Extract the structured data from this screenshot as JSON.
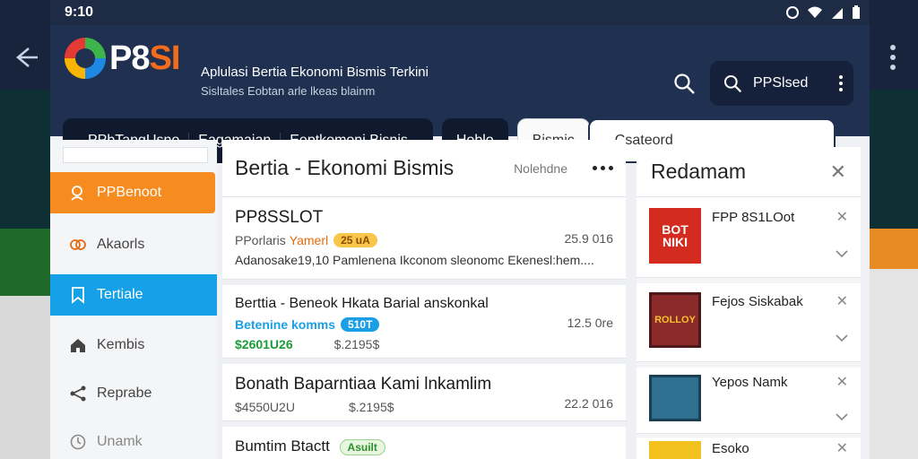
{
  "outer": {
    "back_icon": "back-arrow-icon",
    "more_icon": "more-vertical-icon"
  },
  "statusbar": {
    "time": "9:10",
    "icons": [
      "signal-icon",
      "wifi-icon",
      "battery-icon"
    ]
  },
  "app": {
    "logo_text_a": "P8",
    "logo_text_b": "SI",
    "title": "Aplulasi Bertia Ekonomi Bismis Terkini",
    "subtitle": "Sisltales Eobtan arle lkeas blainm",
    "search_label": "PPSlsed"
  },
  "tabs": {
    "group": [
      "PPbTangUsno",
      "Eagamaian",
      "Eeptkomoni Bisnis"
    ],
    "hoblo": "Hoblo",
    "bismic": "Bismic",
    "active": "Csateord"
  },
  "sidebar": {
    "items": [
      {
        "label": "PPBenoot",
        "icon": "person-search-icon"
      },
      {
        "label": "Akaorls",
        "icon": "link-icon"
      },
      {
        "label": "Tertiale",
        "icon": "bookmark-icon"
      },
      {
        "label": "Kembis",
        "icon": "home-icon"
      },
      {
        "label": "Reprabe",
        "icon": "share-icon"
      },
      {
        "label": "Unamk",
        "icon": "clock-icon"
      }
    ]
  },
  "center": {
    "title": "Bertia - Ekonomi Bismis",
    "note": "Nolehdne",
    "cards": [
      {
        "title": "PP8SSLOT",
        "sub": "PPorlaris",
        "sub_accent": "Yamerl",
        "badge": "25 uA",
        "time": "25.9 016",
        "body": "Adanosake19,10 Pamlenena Ikconom sleonomc Ekenesl:hem...."
      },
      {
        "title": "Berttia - Beneok Hkata Barial anskonkal",
        "sub_accent": "Betenine komms",
        "badge": "510T",
        "time": "12.5 0re",
        "price1": "$2601U26",
        "price2": "$.2195$"
      },
      {
        "title": "Bonath Baparntiaa Kami lnkamlim",
        "price1": "$4550U2U",
        "price2": "$.2195$",
        "time": "22.2 016"
      },
      {
        "title": "Bumtim Btactt",
        "badge": "Asuilt"
      }
    ]
  },
  "right": {
    "title": "Redamam",
    "items": [
      {
        "name": "FPP 8S1LOot",
        "thumb_text": "BOT NIKI"
      },
      {
        "name": "Fejos Siskabak",
        "thumb_text": "ROLLOY"
      },
      {
        "name": "Yepos Namk",
        "thumb_text": ""
      },
      {
        "name": "Esoko",
        "thumb_text": ""
      }
    ]
  }
}
